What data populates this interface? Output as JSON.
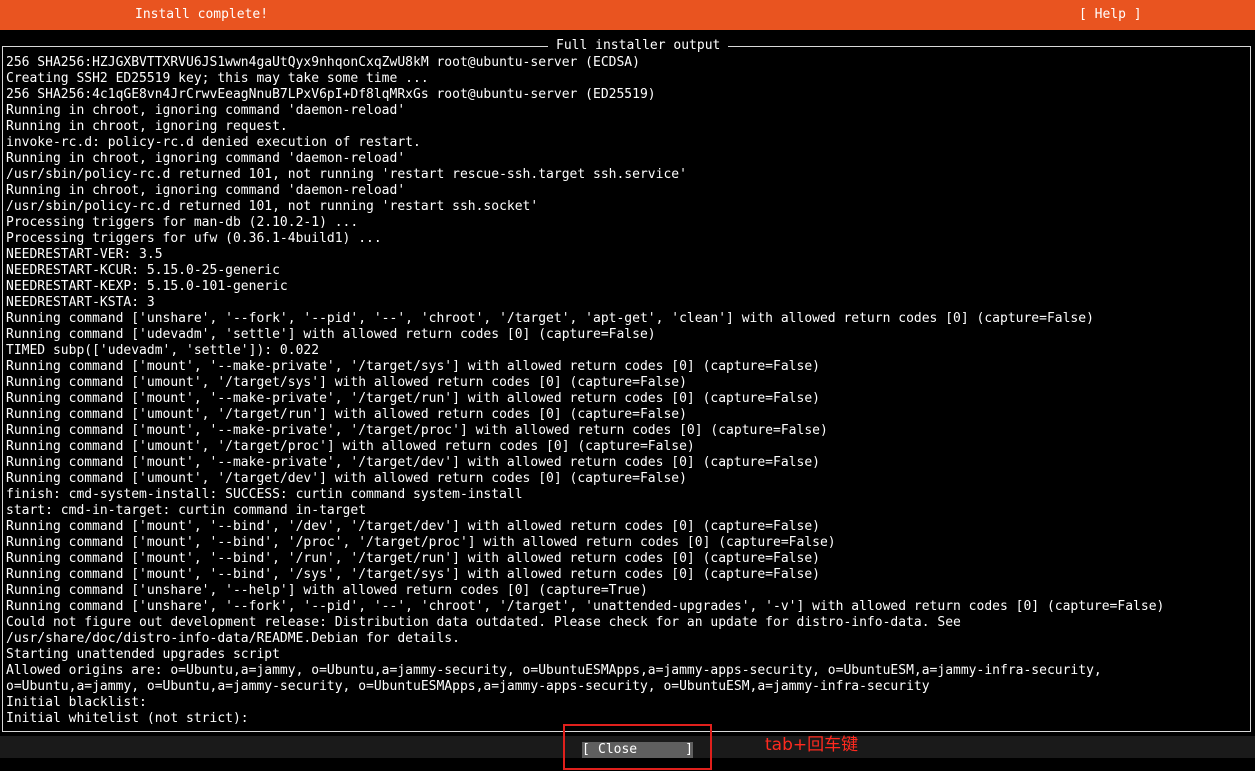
{
  "header": {
    "title": "Install complete!",
    "help_label": "[ Help ]",
    "bg_color": "#e95420"
  },
  "panel": {
    "title": "Full installer output"
  },
  "log_lines": [
    "256 SHA256:HZJGXBVTTXRVU6JS1wwn4gaUtQyx9nhqonCxqZwU8kM root@ubuntu-server (ECDSA)",
    "Creating SSH2 ED25519 key; this may take some time ...",
    "256 SHA256:4c1qGE8vn4JrCrwvEeagNnuB7LPxV6pI+Df8lqMRxGs root@ubuntu-server (ED25519)",
    "Running in chroot, ignoring command 'daemon-reload'",
    "Running in chroot, ignoring request.",
    "invoke-rc.d: policy-rc.d denied execution of restart.",
    "Running in chroot, ignoring command 'daemon-reload'",
    "/usr/sbin/policy-rc.d returned 101, not running 'restart rescue-ssh.target ssh.service'",
    "Running in chroot, ignoring command 'daemon-reload'",
    "/usr/sbin/policy-rc.d returned 101, not running 'restart ssh.socket'",
    "Processing triggers for man-db (2.10.2-1) ...",
    "Processing triggers for ufw (0.36.1-4build1) ...",
    "NEEDRESTART-VER: 3.5",
    "NEEDRESTART-KCUR: 5.15.0-25-generic",
    "NEEDRESTART-KEXP: 5.15.0-101-generic",
    "NEEDRESTART-KSTA: 3",
    "Running command ['unshare', '--fork', '--pid', '--', 'chroot', '/target', 'apt-get', 'clean'] with allowed return codes [0] (capture=False)",
    "Running command ['udevadm', 'settle'] with allowed return codes [0] (capture=False)",
    "TIMED subp(['udevadm', 'settle']): 0.022",
    "Running command ['mount', '--make-private', '/target/sys'] with allowed return codes [0] (capture=False)",
    "Running command ['umount', '/target/sys'] with allowed return codes [0] (capture=False)",
    "Running command ['mount', '--make-private', '/target/run'] with allowed return codes [0] (capture=False)",
    "Running command ['umount', '/target/run'] with allowed return codes [0] (capture=False)",
    "Running command ['mount', '--make-private', '/target/proc'] with allowed return codes [0] (capture=False)",
    "Running command ['umount', '/target/proc'] with allowed return codes [0] (capture=False)",
    "Running command ['mount', '--make-private', '/target/dev'] with allowed return codes [0] (capture=False)",
    "Running command ['umount', '/target/dev'] with allowed return codes [0] (capture=False)",
    "finish: cmd-system-install: SUCCESS: curtin command system-install",
    "start: cmd-in-target: curtin command in-target",
    "Running command ['mount', '--bind', '/dev', '/target/dev'] with allowed return codes [0] (capture=False)",
    "Running command ['mount', '--bind', '/proc', '/target/proc'] with allowed return codes [0] (capture=False)",
    "Running command ['mount', '--bind', '/run', '/target/run'] with allowed return codes [0] (capture=False)",
    "Running command ['mount', '--bind', '/sys', '/target/sys'] with allowed return codes [0] (capture=False)",
    "Running command ['unshare', '--help'] with allowed return codes [0] (capture=True)",
    "Running command ['unshare', '--fork', '--pid', '--', 'chroot', '/target', 'unattended-upgrades', '-v'] with allowed return codes [0] (capture=False)",
    "Could not figure out development release: Distribution data outdated. Please check for an update for distro-info-data. See",
    "/usr/share/doc/distro-info-data/README.Debian for details.",
    "Starting unattended upgrades script",
    "Allowed origins are: o=Ubuntu,a=jammy, o=Ubuntu,a=jammy-security, o=UbuntuESMApps,a=jammy-apps-security, o=UbuntuESM,a=jammy-infra-security,",
    "o=Ubuntu,a=jammy, o=Ubuntu,a=jammy-security, o=UbuntuESMApps,a=jammy-apps-security, o=UbuntuESM,a=jammy-infra-security",
    "Initial blacklist:",
    "Initial whitelist (not strict):"
  ],
  "close_button": {
    "left_bracket": "[",
    "label": "Close",
    "right_bracket": "]"
  },
  "annotation": {
    "text": "tab+回车键",
    "color": "#e0201c"
  }
}
